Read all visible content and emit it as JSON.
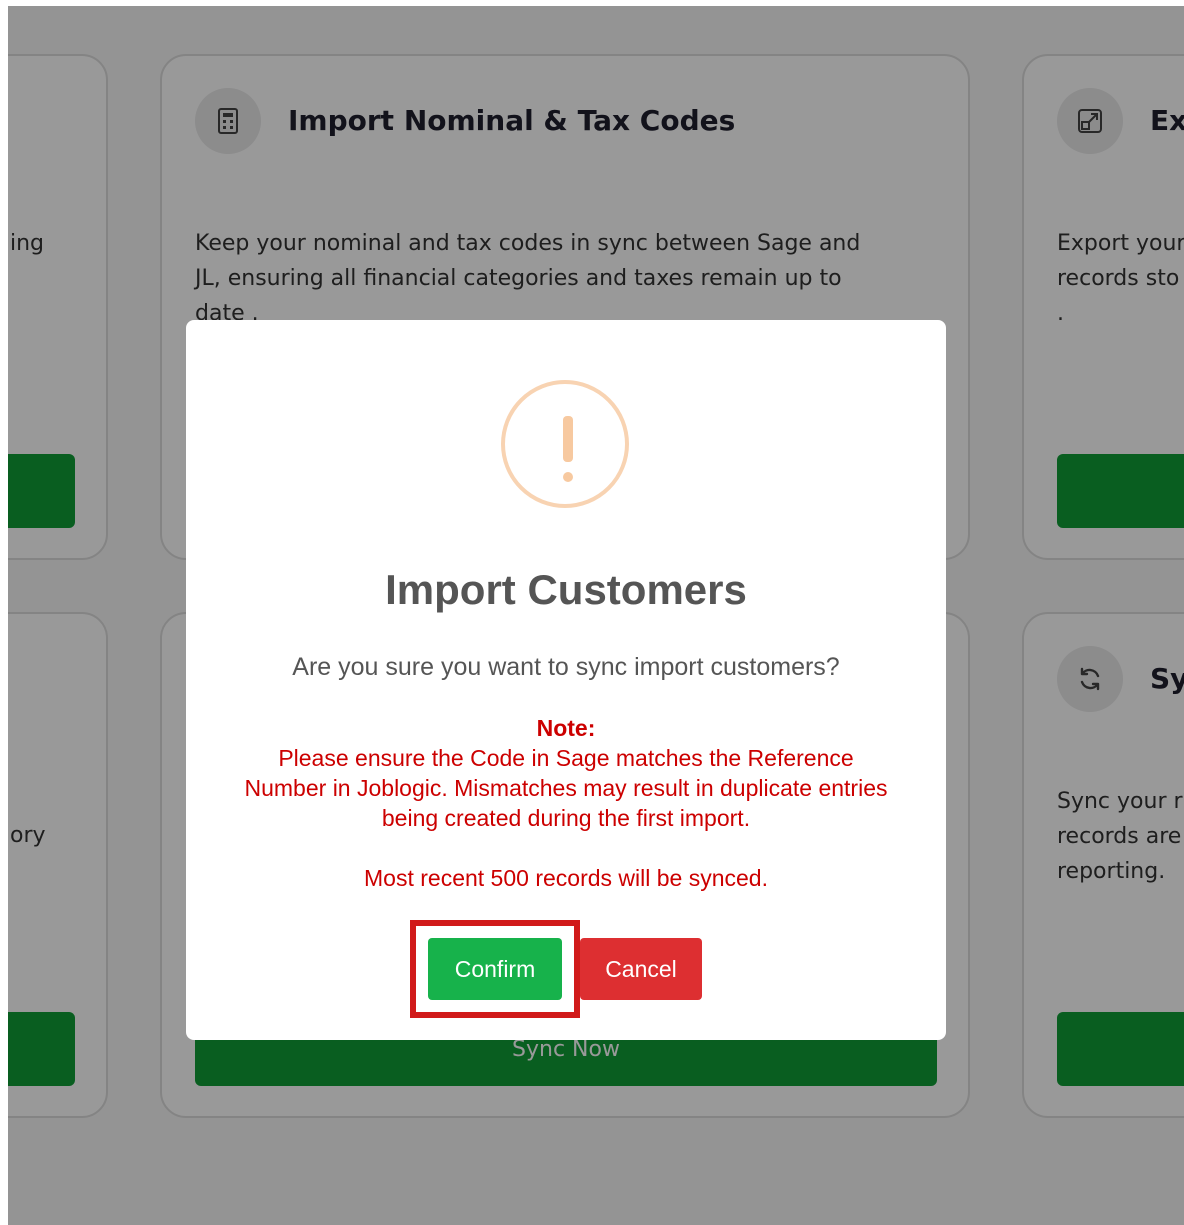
{
  "cards": [
    {
      "key": "left_top",
      "desc": [
        "ing"
      ]
    },
    {
      "key": "nominal",
      "title": "Import Nominal & Tax Codes",
      "icon": "calculator-icon",
      "desc": [
        "Keep your nominal and tax codes in sync between Sage and",
        "JL, ensuring all financial categories and taxes remain up to",
        "date ."
      ]
    },
    {
      "key": "export",
      "title": "Ex",
      "icon": "export-icon",
      "desc": [
        "Export your",
        "records sto",
        "."
      ]
    },
    {
      "key": "left_bottom",
      "desc": [
        "ory"
      ]
    },
    {
      "key": "middle_bottom",
      "button": "Sync Now"
    },
    {
      "key": "sync",
      "title": "Sy",
      "icon": "refresh-icon",
      "desc": [
        "Sync your r",
        "records are",
        "reporting."
      ]
    }
  ],
  "modal": {
    "icon": "warning-icon",
    "title": "Import Customers",
    "question": "Are you sure you want to sync import customers?",
    "note_label": "Note:",
    "note_lines": [
      "Please ensure the Code in Sage matches the Reference",
      "Number in Joblogic. Mismatches may result in duplicate entries",
      "being created during the first import."
    ],
    "records": "Most recent 500 records will be synced.",
    "confirm_label": "Confirm",
    "cancel_label": "Cancel"
  },
  "colors": {
    "primary_green": "#0f9d36",
    "confirm_green": "#17b24b",
    "cancel_red": "#dd2f31",
    "note_red": "#cc0000",
    "highlight_red": "#d11a1a"
  }
}
